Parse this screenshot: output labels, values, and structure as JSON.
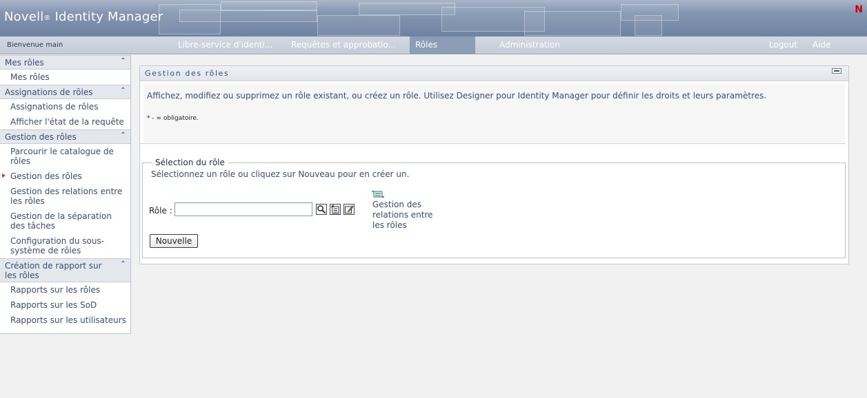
{
  "header": {
    "brand": "Novell",
    "brand_reg": "®",
    "product": " Identity Manager",
    "corner_logo": "N"
  },
  "navbar": {
    "welcome": "Bienvenue main",
    "tabs": [
      {
        "label": "Libre-service d'identi..."
      },
      {
        "label": "Requêtes et approbatio..."
      },
      {
        "label": "Rôles"
      },
      {
        "label": "Administration"
      }
    ],
    "active_tab": "Rôles",
    "logout": "Logout",
    "help": "Aide"
  },
  "sidebar": {
    "collapse_glyph": "⌃",
    "sections": [
      {
        "title": "Mes rôles",
        "items": [
          "Mes rôles"
        ]
      },
      {
        "title": "Assignations de rôles",
        "items": [
          "Assignations de rôles",
          "Afficher l'état de la requête"
        ]
      },
      {
        "title": "Gestion des rôles",
        "items": [
          "Parcourir le catalogue de rôles",
          "Gestion des rôles",
          "Gestion des relations entre les rôles",
          "Gestion de la séparation des tâches",
          "Configuration du sous-système de rôles"
        ]
      },
      {
        "title": "Création de rapport sur les rôles",
        "items": [
          "Rapports sur les rôles",
          "Rapports sur les SoD",
          "Rapports sur les utilisateurs"
        ]
      }
    ],
    "current_item": "Gestion des rôles"
  },
  "panel": {
    "title": "Gestion des rôles",
    "description": "Affichez, modifiez ou supprimez un rôle existant, ou créez un rôle. Utilisez Designer pour Identity Manager pour définir les droits et leurs paramètres.",
    "required_note": "* - = obligatoire.",
    "fieldset": {
      "legend": "Sélection du rôle",
      "hint": "Sélectionnez un rôle ou cliquez sur Nouveau pour en créer un.",
      "role_label": "Rôle :",
      "role_value": "",
      "new_button": "Nouvelle",
      "relations_link": "Gestion des relations entre les rôles"
    }
  },
  "colors": {
    "banner": "#7d90ad",
    "text": "#3a4e6e",
    "active_tab": "#8c9db6",
    "current_marker": "#d2343b"
  },
  "icons": {
    "search": "search-icon",
    "history": "history-icon",
    "edit": "edit-icon",
    "relations": "role-relations-icon",
    "maximize": "maximize-icon",
    "collapse": "chevron-up-double-icon"
  }
}
